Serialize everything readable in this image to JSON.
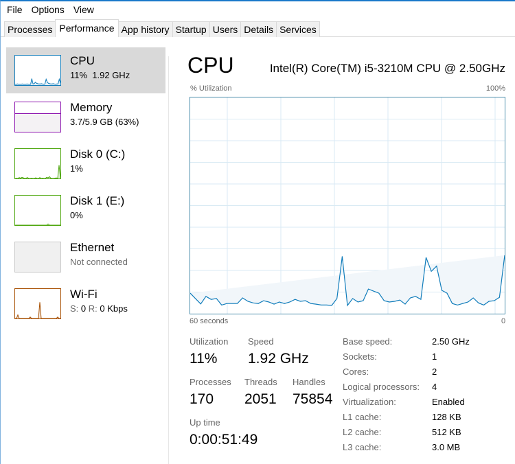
{
  "menu": [
    "File",
    "Options",
    "View"
  ],
  "tabs": [
    {
      "label": "Processes",
      "active": false
    },
    {
      "label": "Performance",
      "active": true
    },
    {
      "label": "App history",
      "active": false
    },
    {
      "label": "Startup",
      "active": false
    },
    {
      "label": "Users",
      "active": false
    },
    {
      "label": "Details",
      "active": false
    },
    {
      "label": "Services",
      "active": false
    }
  ],
  "sidebar": {
    "items": [
      {
        "title": "CPU",
        "sub": "11%  1.92 GHz",
        "color": "#117dbb",
        "selected": true,
        "history": [
          3,
          3,
          4,
          3,
          3,
          3,
          4,
          3,
          3,
          3,
          4,
          3,
          3,
          3,
          22,
          4,
          5,
          10,
          6,
          5,
          4,
          4,
          5,
          4,
          3,
          4,
          20,
          10,
          6,
          5,
          4,
          4,
          5,
          4,
          3,
          4,
          4,
          20,
          8
        ]
      },
      {
        "title": "Memory",
        "sub": "3.7/5.9 GB (63%)",
        "color": "#8b12ae",
        "selected": false,
        "fill_fraction": 0.63
      },
      {
        "title": "Disk 0 (C:)",
        "sub": "1%",
        "color": "#4da60c",
        "selected": false,
        "history": [
          0,
          1,
          0,
          3,
          1,
          4,
          2,
          0,
          1,
          3,
          0,
          0,
          1,
          0,
          0,
          2,
          0,
          0,
          3,
          0,
          1,
          0,
          0,
          4,
          2,
          6,
          1,
          0,
          0,
          1,
          2,
          0,
          45,
          2
        ]
      },
      {
        "title": "Disk 1 (E:)",
        "sub": "0%",
        "color": "#4da60c",
        "selected": false,
        "history": [
          0,
          0,
          0,
          0,
          0,
          0,
          0,
          0,
          0,
          0,
          0,
          0,
          0,
          0,
          0,
          0,
          0,
          0,
          0,
          0,
          0,
          0,
          0,
          0,
          4,
          0,
          0,
          0,
          0,
          0,
          0,
          0,
          0,
          0
        ]
      },
      {
        "title": "Ethernet",
        "sub": "Not connected",
        "color": "#a6a6a6",
        "selected": false,
        "disconnected": true
      },
      {
        "title": "Wi-Fi",
        "sub_s_label": "S:",
        "sub_s_value": "0",
        "sub_r_label": "R:",
        "sub_r_value": "0 Kbps",
        "color": "#a74f01",
        "selected": false,
        "history": [
          0,
          0,
          12,
          0,
          0,
          0,
          0,
          0,
          0,
          0,
          0,
          5,
          0,
          0,
          0,
          0,
          0,
          0,
          55,
          0,
          0,
          0,
          0,
          0,
          0,
          0,
          0,
          0,
          0,
          0,
          0,
          5,
          0,
          0
        ]
      }
    ]
  },
  "main": {
    "title": "CPU",
    "model": "Intel(R) Core(TM) i5-3210M CPU @ 2.50GHz",
    "y_axis_label": "% Utilization",
    "y_axis_max": "100%",
    "x_axis_left": "60 seconds",
    "x_axis_right": "0",
    "stats": {
      "utilization_label": "Utilization",
      "utilization_value": "11%",
      "speed_label": "Speed",
      "speed_value": "1.92 GHz",
      "processes_label": "Processes",
      "processes_value": "170",
      "threads_label": "Threads",
      "threads_value": "2051",
      "handles_label": "Handles",
      "handles_value": "75854",
      "uptime_label": "Up time",
      "uptime_value": "0:00:51:49"
    },
    "specs": [
      {
        "label": "Base speed:",
        "value": "2.50 GHz"
      },
      {
        "label": "Sockets:",
        "value": "1"
      },
      {
        "label": "Cores:",
        "value": "2"
      },
      {
        "label": "Logical processors:",
        "value": "4"
      },
      {
        "label": "Virtualization:",
        "value": "Enabled"
      },
      {
        "label": "L1 cache:",
        "value": "128 KB"
      },
      {
        "label": "L2 cache:",
        "value": "512 KB"
      },
      {
        "label": "L3 cache:",
        "value": "3.0 MB"
      }
    ]
  },
  "chart_data": {
    "type": "area",
    "title": "CPU",
    "ylabel": "% Utilization",
    "xlabel": "60 seconds",
    "ylim": [
      0,
      100
    ],
    "xlim": [
      60,
      0
    ],
    "grid": true,
    "line_color": "#117dbb",
    "fill_color": "#f1f6fa",
    "grid_color": "#d9eaf4",
    "x": [
      60,
      59,
      58,
      57,
      56,
      55,
      54,
      53,
      52,
      51,
      50,
      49,
      48,
      47,
      46,
      45,
      44,
      43,
      42,
      41,
      40,
      39,
      38,
      37,
      36,
      35,
      34,
      33,
      32,
      31,
      30,
      29,
      28,
      27,
      26,
      25,
      24,
      23,
      22,
      21,
      20,
      19,
      18,
      17,
      16,
      15,
      14,
      13,
      12,
      11,
      10,
      9,
      8,
      7,
      6,
      5,
      4,
      3,
      2,
      1,
      0
    ],
    "series": [
      {
        "name": "CPU",
        "values": [
          9.5,
          7,
          4.5,
          8,
          6.6,
          7,
          4,
          4.7,
          4.7,
          4.7,
          7.3,
          5.7,
          5,
          4.7,
          6,
          5.4,
          4.4,
          5.4,
          4.7,
          5.4,
          6.6,
          5.7,
          6,
          4.7,
          4.4,
          4,
          4,
          3.8,
          7,
          26.5,
          3.8,
          7,
          5.4,
          6,
          11.4,
          10.4,
          9.5,
          6,
          5.4,
          5.7,
          6.3,
          4.4,
          7.3,
          8,
          6.6,
          26,
          19.6,
          22,
          10.8,
          9.5,
          4.7,
          4,
          4.7,
          5.4,
          7.3,
          5,
          4,
          5.7,
          6,
          7.6,
          27,
          16,
          11
        ]
      }
    ]
  }
}
